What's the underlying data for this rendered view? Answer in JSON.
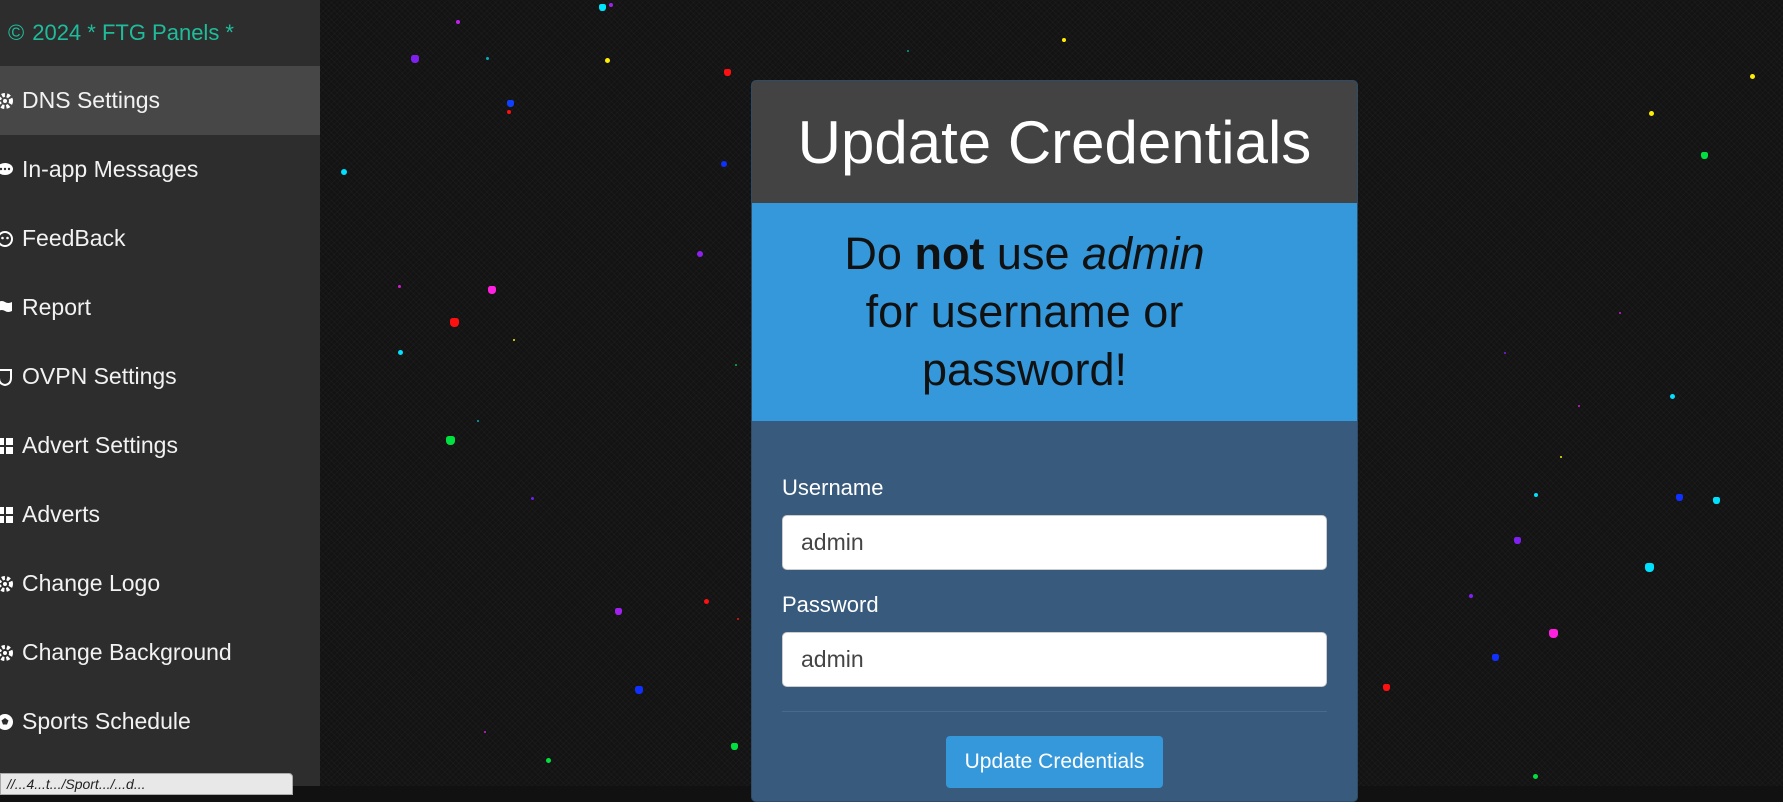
{
  "sidebar": {
    "brand_copyright": "©",
    "brand_text": "2024 * FTG Panels *",
    "items": [
      {
        "label": "DNS Settings",
        "icon": "gear-icon",
        "active": true
      },
      {
        "label": "In-app Messages",
        "icon": "chat-icon"
      },
      {
        "label": "FeedBack",
        "icon": "smile-icon"
      },
      {
        "label": "Report",
        "icon": "flag-icon"
      },
      {
        "label": "OVPN Settings",
        "icon": "shield-icon"
      },
      {
        "label": "Advert Settings",
        "icon": "grid-icon"
      },
      {
        "label": "Adverts",
        "icon": "grid-icon"
      },
      {
        "label": "Change Logo",
        "icon": "gear-icon"
      },
      {
        "label": "Change Background",
        "icon": "gear-icon"
      },
      {
        "label": "Sports Schedule",
        "icon": "soccer-ball-icon"
      }
    ],
    "status_url": "//...4...t.../Sport.../...d..."
  },
  "card": {
    "title": "Update Credentials",
    "warning": {
      "prefix": "Do ",
      "strong": "not",
      "middle": " use ",
      "em": "admin",
      "suffix": " for username or password!"
    },
    "username_label": "Username",
    "username_value": "admin",
    "password_label": "Password",
    "password_value": "admin",
    "submit_label": "Update Credentials"
  },
  "colors": {
    "brand": "#1fbc9c",
    "accent": "#3498db",
    "card_body": "#385a7c",
    "sidebar": "#2d2d2d"
  }
}
